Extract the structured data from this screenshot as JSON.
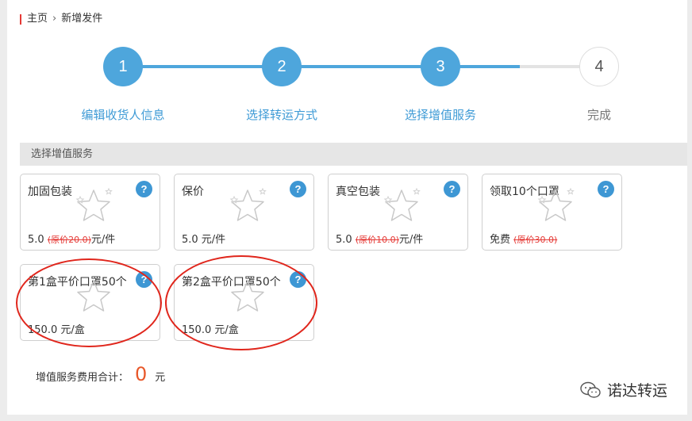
{
  "breadcrumb": {
    "home": "主页",
    "current": "新增发件"
  },
  "steps": [
    {
      "num": "1",
      "label": "编辑收货人信息",
      "status": "done"
    },
    {
      "num": "2",
      "label": "选择转运方式",
      "status": "done"
    },
    {
      "num": "3",
      "label": "选择增值服务",
      "status": "current"
    },
    {
      "num": "4",
      "label": "完成",
      "status": "pending"
    }
  ],
  "section_title": "选择增值服务",
  "services": [
    {
      "title": "加固包装",
      "price": "5.0",
      "original": "(原价20.0)",
      "unit": "元/件"
    },
    {
      "title": "保价",
      "price": "5.0 元/件",
      "original": "",
      "unit": ""
    },
    {
      "title": "真空包装",
      "price": "5.0",
      "original": "(原价10.0)",
      "unit": "元/件"
    },
    {
      "title": "领取10个口罩",
      "price": "免费",
      "original": "(原价30.0)",
      "unit": ""
    },
    {
      "title": "第1盒平价口罩50个",
      "price": "150.0 元/盒",
      "original": "",
      "unit": ""
    },
    {
      "title": "第2盒平价口罩50个",
      "price": "150.0 元/盒",
      "original": "",
      "unit": ""
    }
  ],
  "help_glyph": "?",
  "total": {
    "label": "增值服务费用合计：",
    "value": "0",
    "unit": "元"
  },
  "watermark": "诺达转运",
  "colors": {
    "accent": "#4ea6dc",
    "annotation": "#e0261c",
    "total": "#e8582a"
  }
}
